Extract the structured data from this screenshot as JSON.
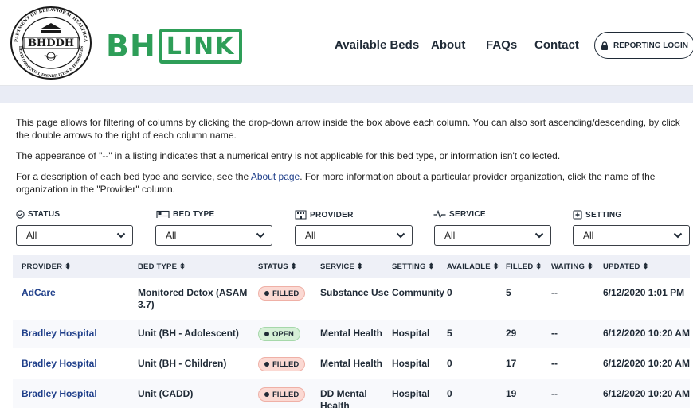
{
  "header": {
    "seal": {
      "top_text": "DEPARTMENT OF BEHAVIORAL HEALTHCARE",
      "center_text": "BHDDH",
      "bottom_text": "DEVELOPMENTAL DISABILITIES & HOSPITALS"
    },
    "brand": {
      "part1": "BH",
      "part2": "LINK"
    },
    "nav": [
      "Available Beds",
      "About",
      "FAQs",
      "Contact"
    ],
    "login_label": "REPORTING LOGIN"
  },
  "intro": {
    "p1": "This page allows for filtering of columns by clicking the drop-down arrow inside the box above each column. You can also sort ascending/descending, by click the double arrows to the right of each column name.",
    "p2": "The appearance of \"--\" in a listing indicates that a numerical entry is not applicable for this bed type, or information isn't collected.",
    "p3_before": "For a description of each bed type and service, see the ",
    "p3_link": "About page",
    "p3_after": ". For more information about a particular provider organization, click the name of the organization in the \"Provider\" column."
  },
  "filters": [
    {
      "label": "STATUS",
      "icon": "check-circle-icon",
      "value": "All"
    },
    {
      "label": "BED TYPE",
      "icon": "bed-icon",
      "value": "All"
    },
    {
      "label": "PROVIDER",
      "icon": "building-icon",
      "value": "All"
    },
    {
      "label": "SERVICE",
      "icon": "pulse-icon",
      "value": "All"
    },
    {
      "label": "SETTING",
      "icon": "hospital-icon",
      "value": "All"
    }
  ],
  "table": {
    "sort_glyph": "⬍",
    "headers": [
      "PROVIDER",
      "BED TYPE",
      "STATUS",
      "SERVICE",
      "SETTING",
      "AVAILABLE",
      "FILLED",
      "WAITING",
      "UPDATED"
    ],
    "rows": [
      {
        "provider": "AdCare",
        "bed_type": "Monitored Detox (ASAM 3.7)",
        "status": "FILLED",
        "service": "Substance Use",
        "setting": "Community",
        "available": "0",
        "filled": "5",
        "waiting": "--",
        "updated": "6/12/2020 1:01 PM"
      },
      {
        "provider": "Bradley Hospital",
        "bed_type": "Unit (BH - Adolescent)",
        "status": "OPEN",
        "service": "Mental Health",
        "setting": "Hospital",
        "available": "5",
        "filled": "29",
        "waiting": "--",
        "updated": "6/12/2020 10:20 AM"
      },
      {
        "provider": "Bradley Hospital",
        "bed_type": "Unit (BH - Children)",
        "status": "FILLED",
        "service": "Mental Health",
        "setting": "Hospital",
        "available": "0",
        "filled": "17",
        "waiting": "--",
        "updated": "6/12/2020 10:20 AM"
      },
      {
        "provider": "Bradley Hospital",
        "bed_type": "Unit (CADD)",
        "status": "FILLED",
        "service": "DD Mental Health",
        "setting": "Hospital",
        "available": "0",
        "filled": "19",
        "waiting": "--",
        "updated": "6/12/2020 10:20 AM"
      }
    ]
  },
  "colors": {
    "brand_green": "#2e9e58",
    "link_blue": "#1f3f8a",
    "filled_badge": "#fbd9d3",
    "open_badge": "#d5efd6"
  }
}
